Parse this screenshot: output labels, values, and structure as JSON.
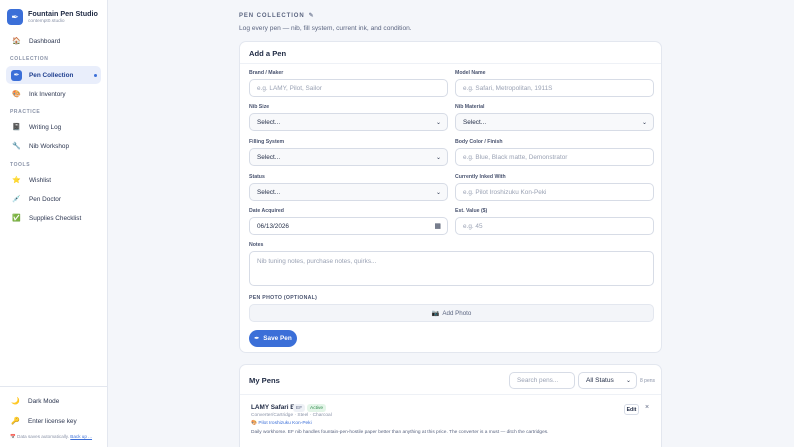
{
  "app": {
    "title": "Fountain Pen Studio",
    "subtitle": "contempt0.studio",
    "logo_icon": "pen-nib-icon"
  },
  "sidebar": {
    "sections": {
      "collection": "COLLECTION",
      "practice": "PRACTICE",
      "tools": "TOOLS"
    },
    "items": {
      "dashboard": {
        "label": "Dashboard",
        "icon": "home-icon"
      },
      "pen_collection": {
        "label": "Pen Collection",
        "icon": "pen-nib-icon",
        "active": true
      },
      "ink_inventory": {
        "label": "Ink Inventory",
        "icon": "palette-icon"
      },
      "writing_log": {
        "label": "Writing Log",
        "icon": "notebook-icon"
      },
      "nib_workshop": {
        "label": "Nib Workshop",
        "icon": "wrench-icon"
      },
      "wishlist": {
        "label": "Wishlist",
        "icon": "star-icon"
      },
      "pen_doctor": {
        "label": "Pen Doctor",
        "icon": "syringe-icon"
      },
      "supplies_checklist": {
        "label": "Supplies Checklist",
        "icon": "checkbox-icon"
      }
    },
    "bottom": {
      "dark_mode": "Dark Mode",
      "license": "Enter license key",
      "note": "Data saves automatically.",
      "backup_link": "Back up ..."
    }
  },
  "header": {
    "kicker": "PEN COLLECTION",
    "description": "Log every pen — nib, fill system, current ink, and condition."
  },
  "form": {
    "title": "Add a Pen",
    "brand": {
      "label": "Brand / Maker",
      "placeholder": "e.g. LAMY, Pilot, Sailor"
    },
    "model": {
      "label": "Model Name",
      "placeholder": "e.g. Safari, Metropolitan, 1911S"
    },
    "nib_size": {
      "label": "Nib Size",
      "value": "Select..."
    },
    "nib_material": {
      "label": "Nib Material",
      "value": "Select..."
    },
    "filling": {
      "label": "Filling System",
      "value": "Select..."
    },
    "body_color": {
      "label": "Body Color / Finish",
      "placeholder": "e.g. Blue, Black matte, Demonstrator"
    },
    "status": {
      "label": "Status",
      "value": "Select..."
    },
    "inked": {
      "label": "Currently Inked With",
      "placeholder": "e.g. Pilot Iroshizuku Kon-Peki"
    },
    "date": {
      "label": "Date Acquired",
      "value": "06/13/2026"
    },
    "value": {
      "label": "Est. Value ($)",
      "placeholder": "e.g. 45"
    },
    "notes": {
      "label": "Notes",
      "placeholder": "Nib tuning notes, purchase notes, quirks..."
    },
    "photo": {
      "label": "PEN PHOTO (OPTIONAL)",
      "button": "Add Photo"
    },
    "save": "Save Pen"
  },
  "pens": {
    "title": "My Pens",
    "search_placeholder": "Search pens...",
    "filter_value": "All Status",
    "count": "8 pens",
    "items": [
      {
        "name": "LAMY Safari EF",
        "nib": "EF",
        "status": "Active",
        "meta": "Converter/Cartridge · Steel · Charcoal",
        "ink": "Pilot Iroshizuku Kon-Peki",
        "notes": "Daily workhorse. EF nib handles fountain-pen-hostile paper better than anything at this price. The converter is a must — ditch the cartridges.",
        "edit": "Edit"
      }
    ]
  },
  "colors": {
    "accent": "#3b6fd8",
    "active_bg": "#e9eefb",
    "status_green": "#2e8a4a"
  }
}
